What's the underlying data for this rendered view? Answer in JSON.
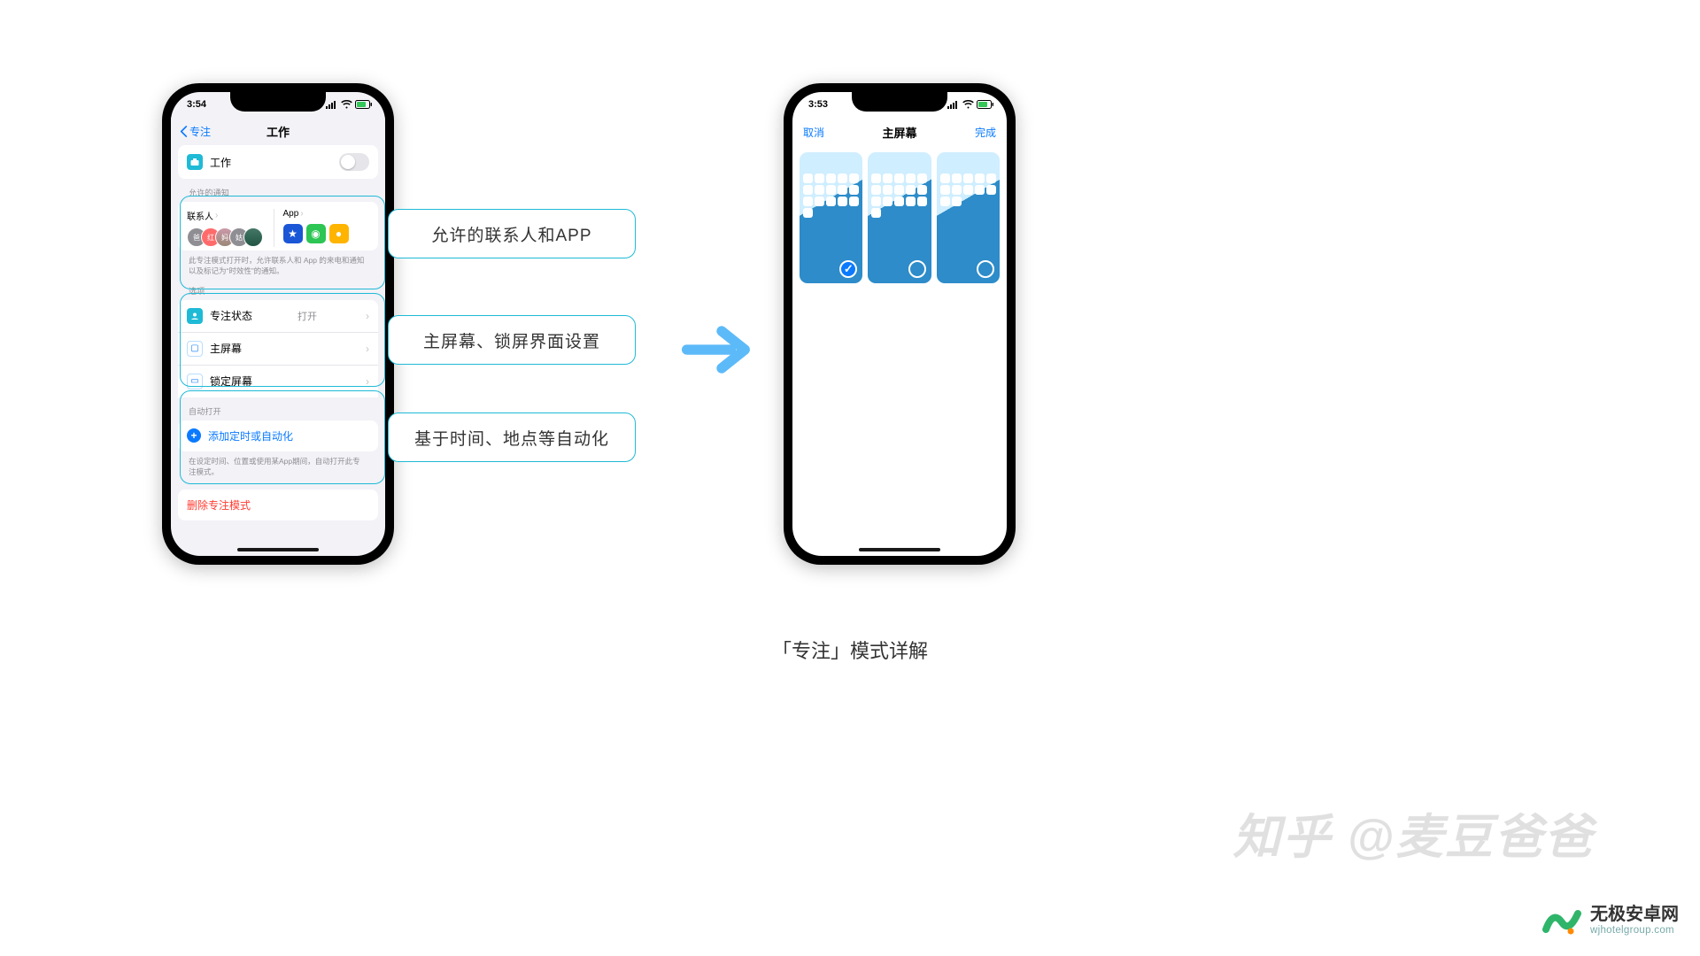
{
  "caption": "「专注」模式详解",
  "left_phone": {
    "time": "3:54",
    "nav": {
      "back": "专注",
      "title": "工作"
    },
    "work_row": {
      "label": "工作"
    },
    "notifications": {
      "header": "允许的通知",
      "contacts_label": "联系人",
      "app_label": "App",
      "contacts": [
        "爸",
        "红",
        "妈",
        "姑",
        ""
      ],
      "footnote": "此专注模式打开时，允许联系人和 App 的来电和通知以及标记为“时效性”的通知。"
    },
    "options": {
      "header": "选项",
      "focus_status": {
        "label": "专注状态",
        "value": "打开"
      },
      "home_screen": {
        "label": "主屏幕"
      },
      "lock_screen": {
        "label": "锁定屏幕"
      }
    },
    "auto": {
      "header": "自动打开",
      "add_label": "添加定时或自动化",
      "footnote": "在设定时间、位置或使用某App期间，自动打开此专注模式。"
    },
    "delete_label": "删除专注模式"
  },
  "callouts": {
    "a": "允许的联系人和APP",
    "b": "主屏幕、锁屏界面设置",
    "c": "基于时间、地点等自动化"
  },
  "right_phone": {
    "time": "3:53",
    "cancel": "取消",
    "title": "主屏幕",
    "done": "完成"
  },
  "watermark": "知乎 @麦豆爸爸",
  "site": {
    "name": "无极安卓网",
    "domain": "wjhotelgroup.com"
  }
}
